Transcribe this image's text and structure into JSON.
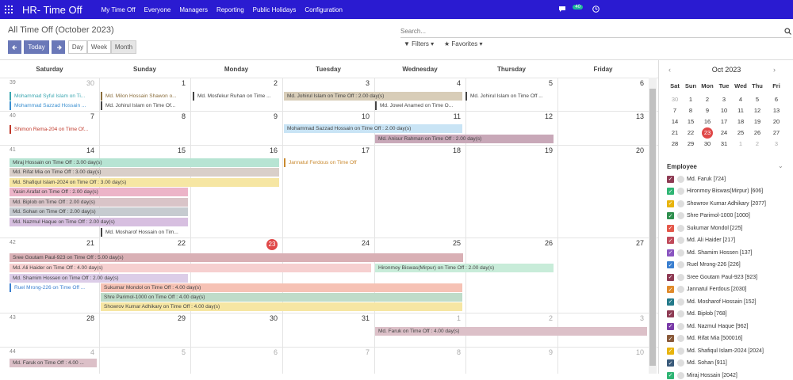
{
  "app": {
    "title": "HR- Time Off",
    "menu": [
      "My Time Off",
      "Everyone",
      "Managers",
      "Reporting",
      "Public Holidays",
      "Configuration"
    ],
    "chat_badge": "40"
  },
  "control_panel": {
    "breadcrumb": "All Time Off (October 2023)",
    "today_label": "Today",
    "views": [
      "Day",
      "Week",
      "Month"
    ],
    "search_placeholder": "Search...",
    "filters_label": "Filters",
    "favorites_label": "Favorites"
  },
  "calendar": {
    "day_headers": [
      "Saturday",
      "Sunday",
      "Monday",
      "Tuesday",
      "Wednesday",
      "Thursday",
      "Friday"
    ],
    "weeks": [
      {
        "wn": "39",
        "days": [
          "30",
          "1",
          "2",
          "3",
          "4",
          "5",
          "6"
        ],
        "muted": [
          1,
          0,
          0,
          0,
          0,
          0,
          0
        ]
      },
      {
        "wn": "40",
        "days": [
          "7",
          "8",
          "9",
          "10",
          "11",
          "12",
          "13"
        ],
        "muted": [
          0,
          0,
          0,
          0,
          0,
          0,
          0
        ]
      },
      {
        "wn": "41",
        "days": [
          "14",
          "15",
          "16",
          "17",
          "18",
          "19",
          "20"
        ],
        "muted": [
          0,
          0,
          0,
          0,
          0,
          0,
          0
        ]
      },
      {
        "wn": "42",
        "days": [
          "21",
          "22",
          "23",
          "24",
          "25",
          "26",
          "27"
        ],
        "muted": [
          0,
          0,
          0,
          0,
          0,
          0,
          0
        ]
      },
      {
        "wn": "43",
        "days": [
          "28",
          "29",
          "30",
          "31",
          "1",
          "2",
          "3"
        ],
        "muted": [
          0,
          0,
          0,
          0,
          1,
          1,
          1
        ]
      },
      {
        "wn": "44",
        "days": [
          "4",
          "5",
          "6",
          "7",
          "8",
          "9",
          "10"
        ],
        "muted": [
          1,
          1,
          1,
          1,
          1,
          1,
          1
        ]
      }
    ],
    "today_day": "23",
    "events": [
      {
        "t": "Mohammad Syful Islam on Ti...",
        "c": "#3aa6b0",
        "open": true
      },
      {
        "t": "Mohammad Sazzad Hossain ...",
        "c": "#3a8fd0",
        "open": true
      },
      {
        "t": "Md. Milon Hossain Shawon o...",
        "c": "#8a6d3b",
        "open": true
      },
      {
        "t": "Md. Johirul Islam on Time Of...",
        "c": "#444",
        "open": true
      },
      {
        "t": "Md. Mosfekur Ruhan on Time ...",
        "c": "#444",
        "open": true
      },
      {
        "t": "Md. Johirul Islam on Time Off : 2.00 day(s)",
        "c": "#d8cdb8",
        "open": false
      },
      {
        "t": "Md. Jowel Anamed on Time O...",
        "c": "#444",
        "open": true
      },
      {
        "t": "Md. Johirul Islam on Time Off ...",
        "c": "#444",
        "open": true
      },
      {
        "t": "Shimon Rema-204 on Time Of...",
        "c": "#c0392b",
        "open": true
      },
      {
        "t": "Mohammad Sazzad Hossain on Time Off : 2.00 day(s)",
        "c": "#c9e4f5",
        "open": false
      },
      {
        "t": "Md. Anisur Rahman on Time Off : 2.00 day(s)",
        "c": "#c8a8b8",
        "open": false
      },
      {
        "t": "Miraj Hossain on Time Off : 3.00 day(s)",
        "c": "#b7e4d3",
        "open": false
      },
      {
        "t": "Jannatul Ferdous on Time Off",
        "c": "#c9892e",
        "open": true
      },
      {
        "t": "Md. Rifat Mia on Time Off : 3.00 day(s)",
        "c": "#d9cfc9",
        "open": false
      },
      {
        "t": "Md. Shafiqul Islam-2024 on Time Off : 3.00 day(s)",
        "c": "#f6e6a3",
        "open": false
      },
      {
        "t": "Yasin Arafat on Time Off : 2.00 day(s)",
        "c": "#ecb4c8",
        "open": false
      },
      {
        "t": "Md. Biplob on Time Off : 2.00 day(s)",
        "c": "#d9c4c8",
        "open": false
      },
      {
        "t": "Md. Sohan on Time Off : 2.00 day(s)",
        "c": "#c6cbd0",
        "open": false
      },
      {
        "t": "Md. Nazmul Haque on Time Off : 2.00 day(s)",
        "c": "#d7bfe0",
        "open": false
      },
      {
        "t": "Md. Mosharof Hossain on Tim...",
        "c": "#444",
        "open": true
      },
      {
        "t": "Sree Goutam Paul-923 on Time Off : 5.00 day(s)",
        "c": "#d9b0b5",
        "open": false
      },
      {
        "t": "Md. Ali Haider on Time Off : 4.00 day(s)",
        "c": "#f6d0d0",
        "open": false
      },
      {
        "t": "Hironmoy Biswas(Mirpur) on Time Off : 2.00 day(s)",
        "c": "#c8ecd9",
        "open": false
      },
      {
        "t": "Md. Shamim Hossen on Time Off : 2.00 day(s)",
        "c": "#dccde8",
        "open": false
      },
      {
        "t": "Ruel Mrong-226 on Time Off ...",
        "c": "#3a7fd0",
        "open": true
      },
      {
        "t": "Sukumar Mondol on Time Off : 4.00 day(s)",
        "c": "#f6c2b5",
        "open": false
      },
      {
        "t": "Shre Parimol-1000 on Time Off : 4.00 day(s)",
        "c": "#bfdcc9",
        "open": false
      },
      {
        "t": "Showrov Kumar Adhikary on Time Off : 4.00 day(s)",
        "c": "#f6e6a3",
        "open": false
      },
      {
        "t": "Md. Faruk on Time Off : 4.00 day(s)",
        "c": "#dcc0c8",
        "open": false
      },
      {
        "t": "Md. Faruk on Time Off : 4.00 ...",
        "c": "#dcc0c8",
        "open": false
      }
    ]
  },
  "mini_calendar": {
    "title": "Oct 2023",
    "prev": "‹",
    "next": "›",
    "headers": [
      "Sat",
      "Sun",
      "Mon",
      "Tue",
      "Wed",
      "Thu",
      "Fri"
    ],
    "rows": [
      [
        "30",
        "1",
        "2",
        "3",
        "4",
        "5",
        "6"
      ],
      [
        "7",
        "8",
        "9",
        "10",
        "11",
        "12",
        "13"
      ],
      [
        "14",
        "15",
        "16",
        "17",
        "18",
        "19",
        "20"
      ],
      [
        "21",
        "22",
        "23",
        "24",
        "25",
        "26",
        "27"
      ],
      [
        "28",
        "29",
        "30",
        "31",
        "1",
        "2",
        "3"
      ]
    ],
    "today": "23"
  },
  "employee_filter": {
    "title": "Employee",
    "items": [
      {
        "name": "Md. Faruk [724]",
        "color": "#8e3b54"
      },
      {
        "name": "Hironmoy Biswas(Mirpur) [606]",
        "color": "#2fb574"
      },
      {
        "name": "Showrov Kumar Adhikary [2077]",
        "color": "#e8b40d"
      },
      {
        "name": "Shre Parimol-1000 [1000]",
        "color": "#2f8f4e"
      },
      {
        "name": "Sukumar Mondol [225]",
        "color": "#e4584a"
      },
      {
        "name": "Md. Ali Haider [217]",
        "color": "#c04a5a"
      },
      {
        "name": "Md. Shamim Hossen [137]",
        "color": "#8a55c0"
      },
      {
        "name": "Ruel Mrong-226 [226]",
        "color": "#3a7fd0"
      },
      {
        "name": "Sree Goutam Paul-923 [923]",
        "color": "#8e3b54"
      },
      {
        "name": "Jannatul Ferdous [2030]",
        "color": "#e08a2a"
      },
      {
        "name": "Md. Mosharof Hossain [152]",
        "color": "#247a8a"
      },
      {
        "name": "Md. Biplob [768]",
        "color": "#8e3b54"
      },
      {
        "name": "Md. Nazmul Haque [962]",
        "color": "#7a3ba8"
      },
      {
        "name": "Md. Rifat Mia [500016]",
        "color": "#8a5a3a"
      },
      {
        "name": "Md. Shafiqul Islam-2024 [2024]",
        "color": "#e8b40d"
      },
      {
        "name": "Md. Sohan [911]",
        "color": "#3a5a7a"
      },
      {
        "name": "Miraj Hossain [2042]",
        "color": "#2fb574"
      }
    ]
  }
}
